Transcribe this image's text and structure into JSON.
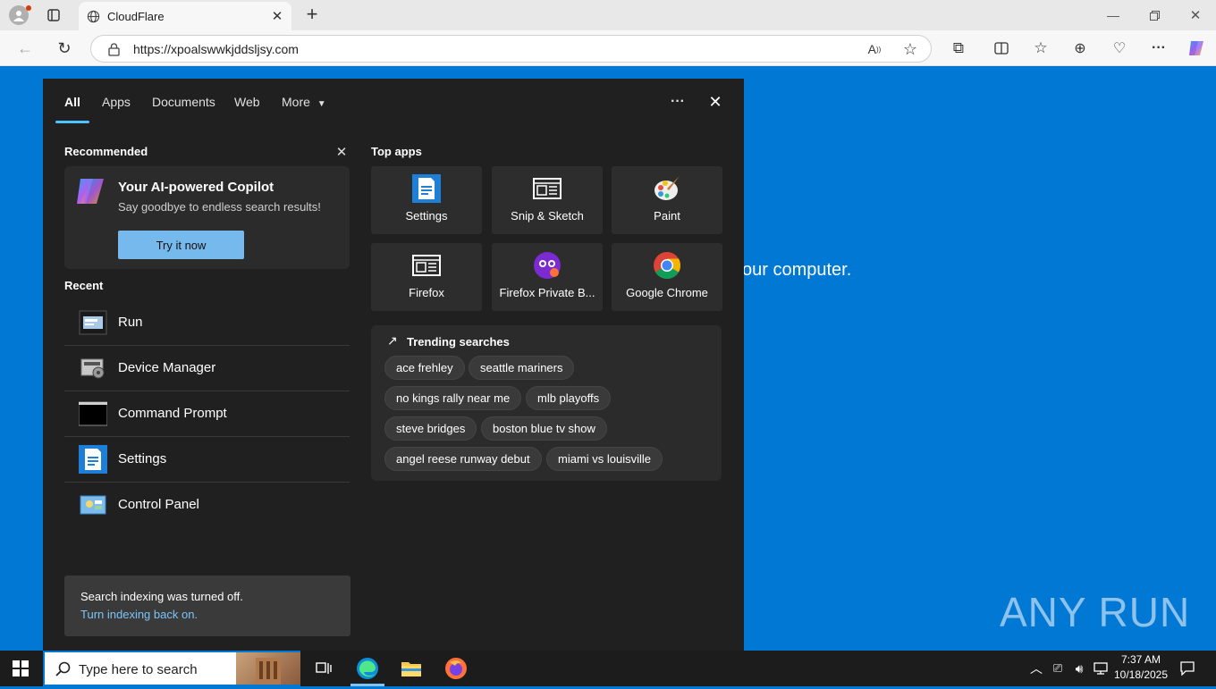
{
  "browser": {
    "tab_title": "CloudFlare",
    "url": "https://xpoalswwkjddsljsy.com",
    "window_controls": [
      "minimize-icon",
      "restore-icon",
      "close-icon"
    ]
  },
  "page": {
    "partial_text": "our computer.",
    "watermark": "ANY RUN"
  },
  "search_panel": {
    "tabs": [
      {
        "label": "All",
        "active": true
      },
      {
        "label": "Apps"
      },
      {
        "label": "Documents"
      },
      {
        "label": "Web"
      },
      {
        "label": "More"
      }
    ],
    "recommended": {
      "title": "Recommended",
      "card_title": "Your AI-powered Copilot",
      "card_subtitle": "Say goodbye to endless search results!",
      "button": "Try it now"
    },
    "recent": {
      "title": "Recent",
      "items": [
        "Run",
        "Device Manager",
        "Command Prompt",
        "Settings",
        "Control Panel"
      ]
    },
    "top_apps": {
      "title": "Top apps",
      "items": [
        "Settings",
        "Snip & Sketch",
        "Paint",
        "Firefox",
        "Firefox Private B...",
        "Google Chrome"
      ]
    },
    "trending": {
      "title": "Trending searches",
      "chips": [
        "ace frehley",
        "seattle mariners",
        "no kings rally near me",
        "mlb playoffs",
        "steve bridges",
        "boston blue tv show",
        "angel reese runway debut",
        "miami vs louisville"
      ]
    },
    "indexing": {
      "message": "Search indexing was turned off.",
      "link": "Turn indexing back on."
    }
  },
  "taskbar": {
    "search_placeholder": "Type here to search",
    "time": "7:37 AM",
    "date": "10/18/2025"
  }
}
